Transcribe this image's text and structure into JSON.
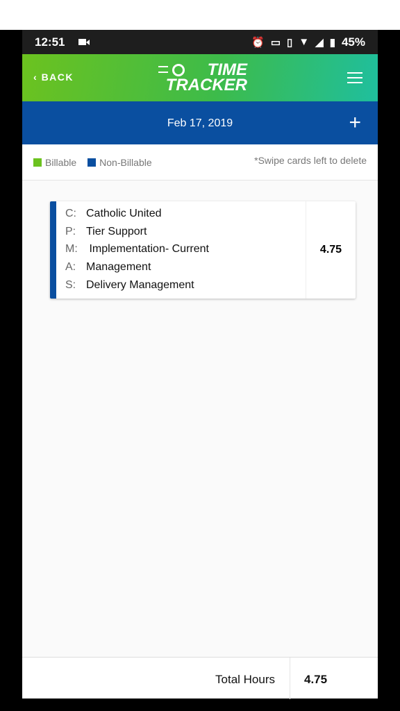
{
  "status_bar": {
    "time": "12:51",
    "battery": "45%",
    "icons": [
      "video-camera-icon",
      "alarm-icon",
      "cast-icon",
      "vibrate-icon",
      "wifi-icon",
      "signal-icon",
      "battery-icon"
    ]
  },
  "header": {
    "back_label": "BACK",
    "logo_line1": "TIME",
    "logo_line2": "TRACKER",
    "menu_icon": "hamburger-icon"
  },
  "date_bar": {
    "date": "Feb 17, 2019",
    "add_icon": "plus-icon"
  },
  "legend": {
    "billable": "Billable",
    "non_billable": "Non-Billable",
    "note": "*Swipe cards left to delete",
    "billable_color": "#6cc21f",
    "non_billable_color": "#0a4fa0"
  },
  "cards": [
    {
      "type": "Non-Billable",
      "rows": [
        {
          "key": "C:",
          "value": "Catholic United"
        },
        {
          "key": "P:",
          "value": "Tier Support"
        },
        {
          "key": "M:",
          "value": " Implementation- Current"
        },
        {
          "key": "A:",
          "value": "Management"
        },
        {
          "key": "S:",
          "value": "Delivery Management"
        }
      ],
      "hours": "4.75"
    }
  ],
  "footer": {
    "total_label": "Total Hours",
    "total_value": "4.75"
  }
}
